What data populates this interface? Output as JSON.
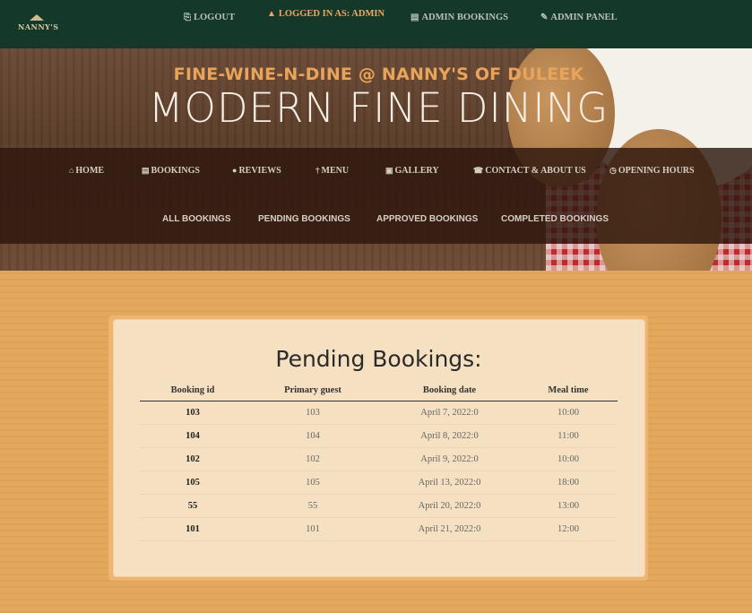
{
  "topbar": {
    "logo_text": "NANNY'S",
    "logout_label": "LOGOUT",
    "logged_in_label": "LOGGED IN AS: ADMIN",
    "admin_bookings_label": "ADMIN BOOKINGS",
    "admin_panel_label": "ADMIN PANEL"
  },
  "hero": {
    "subtitle": "FINE-WINE-N-DINE @ NANNY'S OF DULEEK",
    "title": "MODERN FINE DINING"
  },
  "nav": {
    "items": [
      {
        "label": "HOME",
        "icon": "home-icon",
        "glyph": "⌂"
      },
      {
        "label": "BOOKINGS",
        "icon": "book-icon",
        "glyph": "▤"
      },
      {
        "label": "REVIEWS",
        "icon": "comment-icon",
        "glyph": "●"
      },
      {
        "label": "MENU",
        "icon": "cutlery-icon",
        "glyph": "†"
      },
      {
        "label": "GALLERY",
        "icon": "images-icon",
        "glyph": "▣"
      },
      {
        "label": "CONTACT & ABOUT US",
        "icon": "phone-icon",
        "glyph": "☎"
      },
      {
        "label": "OPENING HOURS",
        "icon": "clock-icon",
        "glyph": "◷"
      }
    ],
    "sub_items": [
      {
        "label": "ALL BOOKINGS"
      },
      {
        "label": "PENDING BOOKINGS"
      },
      {
        "label": "APPROVED BOOKINGS"
      },
      {
        "label": "COMPLETED BOOKINGS"
      }
    ]
  },
  "main": {
    "title": "Pending Bookings:",
    "columns": [
      "Booking id",
      "Primary guest",
      "Booking date",
      "Meal time"
    ],
    "rows": [
      [
        "103",
        "103",
        "April 7, 2022:0",
        "10:00"
      ],
      [
        "104",
        "104",
        "April 8, 2022:0",
        "11:00"
      ],
      [
        "102",
        "102",
        "April 9, 2022:0",
        "10:00"
      ],
      [
        "105",
        "105",
        "April 13, 2022:0",
        "18:00"
      ],
      [
        "55",
        "55",
        "April 20, 2022:0",
        "13:00"
      ],
      [
        "101",
        "101",
        "April 21, 2022:0",
        "12:00"
      ]
    ]
  },
  "colors": {
    "topbar": "#14382a",
    "accent": "#e8a45a",
    "page_bg": "#e3a85b",
    "card_bg": "#f5e0c1"
  }
}
